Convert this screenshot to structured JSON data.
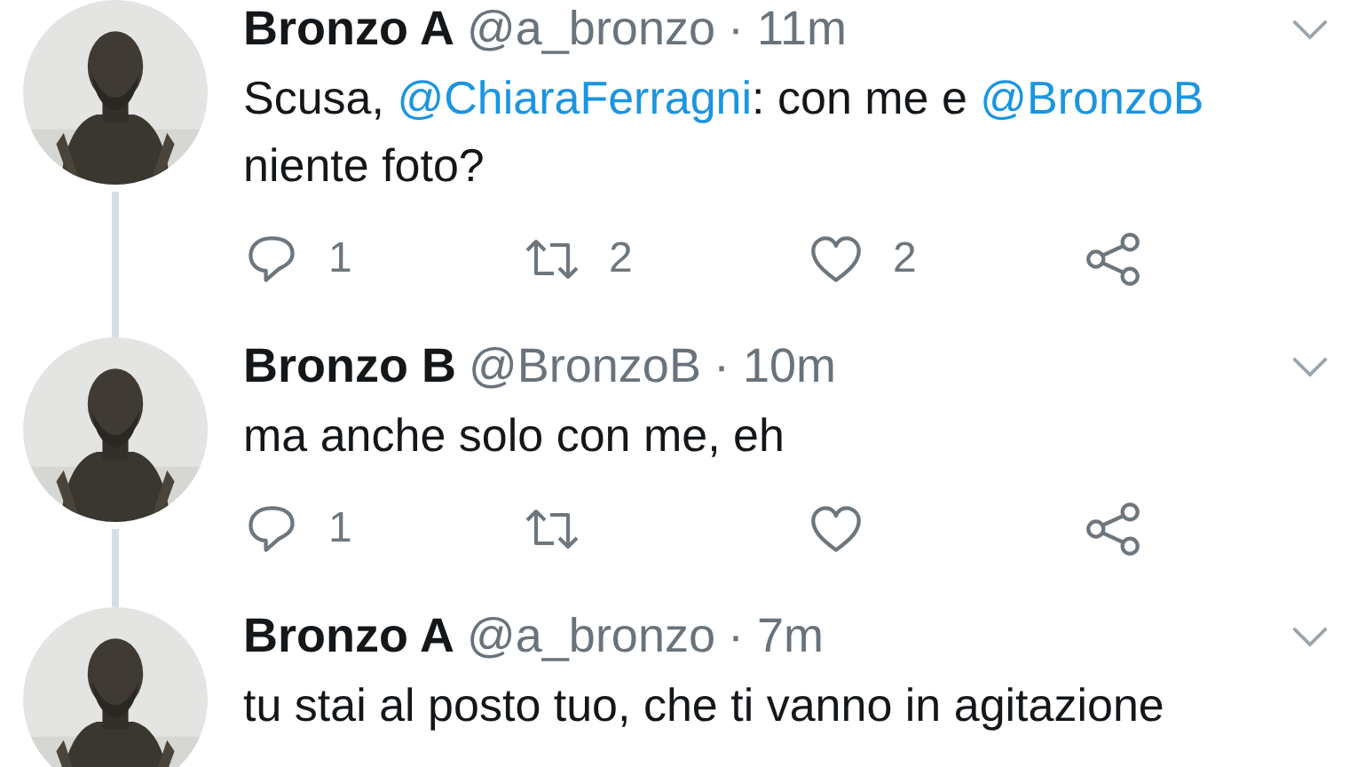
{
  "tweets": [
    {
      "name": "Bronzo A",
      "handle": "@a_bronzo",
      "time": "· 11m",
      "thread_below": true,
      "text": [
        {
          "kind": "plain",
          "text": "Scusa, "
        },
        {
          "kind": "mention",
          "text": "@ChiaraFerragni"
        },
        {
          "kind": "plain",
          "text": ": con me e "
        },
        {
          "kind": "mention",
          "text": "@BronzoB"
        },
        {
          "kind": "plain",
          "text": " niente foto?"
        }
      ],
      "actions": {
        "replies": "1",
        "retweets": "2",
        "likes": "2"
      }
    },
    {
      "name": "Bronzo B",
      "handle": "@BronzoB",
      "time": "· 10m",
      "thread_below": true,
      "text": [
        {
          "kind": "plain",
          "text": "ma anche solo con me, eh"
        }
      ],
      "actions": {
        "replies": "1"
      }
    },
    {
      "name": "Bronzo A",
      "handle": "@a_bronzo",
      "time": "· 7m",
      "thread_below": false,
      "text": [
        {
          "kind": "plain",
          "text": "tu stai al posto tuo, che ti vanno in agitazione"
        }
      ]
    }
  ]
}
